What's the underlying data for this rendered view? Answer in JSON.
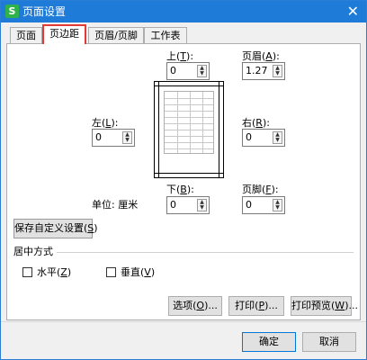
{
  "window": {
    "title": "页面设置",
    "app_icon": "S",
    "close_glyph": "✕"
  },
  "tabs": [
    {
      "label": "页面"
    },
    {
      "label": "页边距",
      "active": true
    },
    {
      "label": "页眉/页脚"
    },
    {
      "label": "工作表"
    }
  ],
  "margins": {
    "top": {
      "label": "上",
      "key": "T",
      "value": "0"
    },
    "header": {
      "label": "页眉",
      "key": "A",
      "value": "1.27"
    },
    "left": {
      "label": "左",
      "key": "L",
      "value": "0"
    },
    "right": {
      "label": "右",
      "key": "R",
      "value": "0"
    },
    "bottom": {
      "label": "下",
      "key": "B",
      "value": "0"
    },
    "footer": {
      "label": "页脚",
      "key": "F",
      "value": "0"
    }
  },
  "unit": {
    "label": "单位: 厘米"
  },
  "save_custom": {
    "label": "保存自定义设置",
    "key": "S"
  },
  "centering": {
    "title": "居中方式",
    "horizontal": {
      "label": "水平",
      "key": "Z",
      "checked": false
    },
    "vertical": {
      "label": "垂直",
      "key": "V",
      "checked": false
    }
  },
  "buttons": {
    "options": {
      "label": "选项",
      "key": "O"
    },
    "print": {
      "label": "打印",
      "key": "P"
    },
    "print_preview": {
      "label": "打印预览",
      "key": "W"
    },
    "ok": {
      "label": "确定"
    },
    "cancel": {
      "label": "取消"
    }
  },
  "colors": {
    "titlebar": "#1e7bd7",
    "active_tab_border": "#e53935",
    "app_icon": "#2fb14c"
  }
}
